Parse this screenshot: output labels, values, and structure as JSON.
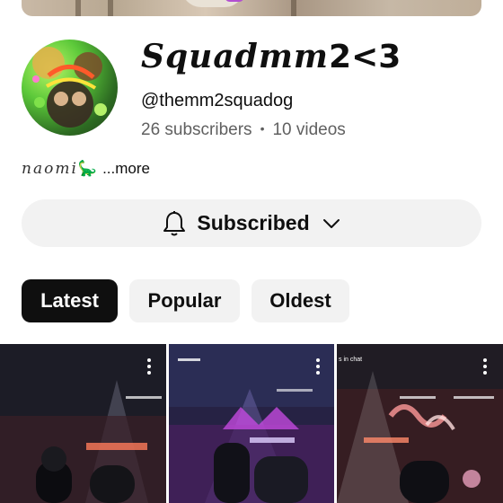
{
  "channel": {
    "name_main": "Squadmm",
    "name_tail": "2<3",
    "handle": "@themm2squadog",
    "subscribers": "26 subscribers",
    "separator": "•",
    "videos": "10 videos"
  },
  "description": {
    "name": "naomi",
    "emoji": "🦕",
    "more": "...more"
  },
  "subscribe": {
    "label": "Subscribed"
  },
  "sort_chips": [
    {
      "label": "Latest",
      "active": true
    },
    {
      "label": "Popular",
      "active": false
    },
    {
      "label": "Oldest",
      "active": false
    }
  ],
  "thumbnails": [
    {
      "overlay": ""
    },
    {
      "overlay": ""
    },
    {
      "overlay": "s in chat"
    }
  ],
  "icons": {
    "bell": "bell-icon",
    "chevron": "chevron-down-icon",
    "more": "more-vert-icon"
  },
  "colors": {
    "active_chip": "#0f0f0f",
    "chip_bg": "#f2f2f2",
    "secondary_text": "#606060"
  }
}
